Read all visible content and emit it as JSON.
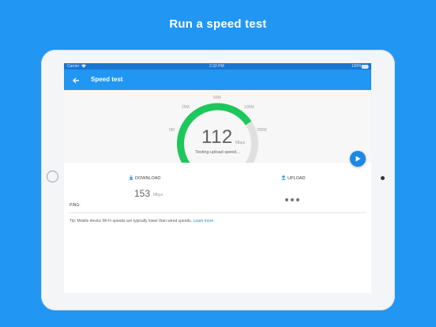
{
  "headline": "Run a speed test",
  "status_bar": {
    "carrier": "Carrier",
    "time": "2:32 PM",
    "battery": "100%"
  },
  "app_bar": {
    "title": "Speed test"
  },
  "gauge": {
    "ticks": [
      "0M",
      "25M",
      "50M",
      "100M",
      "200M"
    ],
    "value": "112",
    "unit": "Mbps",
    "fill_fraction": 0.72,
    "status": "Testing upload speed...",
    "colors": {
      "fill": "#1ec75c",
      "track": "#e0e0e0"
    }
  },
  "results": {
    "download_label": "DOWNLOAD",
    "download_value": "153",
    "download_unit": "Mbps",
    "upload_label": "UPLOAD",
    "ping_label": "PING:"
  },
  "tip": {
    "text": "Tip: Mobile device Wi-Fi speeds are typically lower than wired speeds.",
    "link": "Learn more"
  },
  "colors": {
    "background": "#2196f3",
    "app_bar": "#2196f3",
    "fab": "#1e88e5"
  }
}
